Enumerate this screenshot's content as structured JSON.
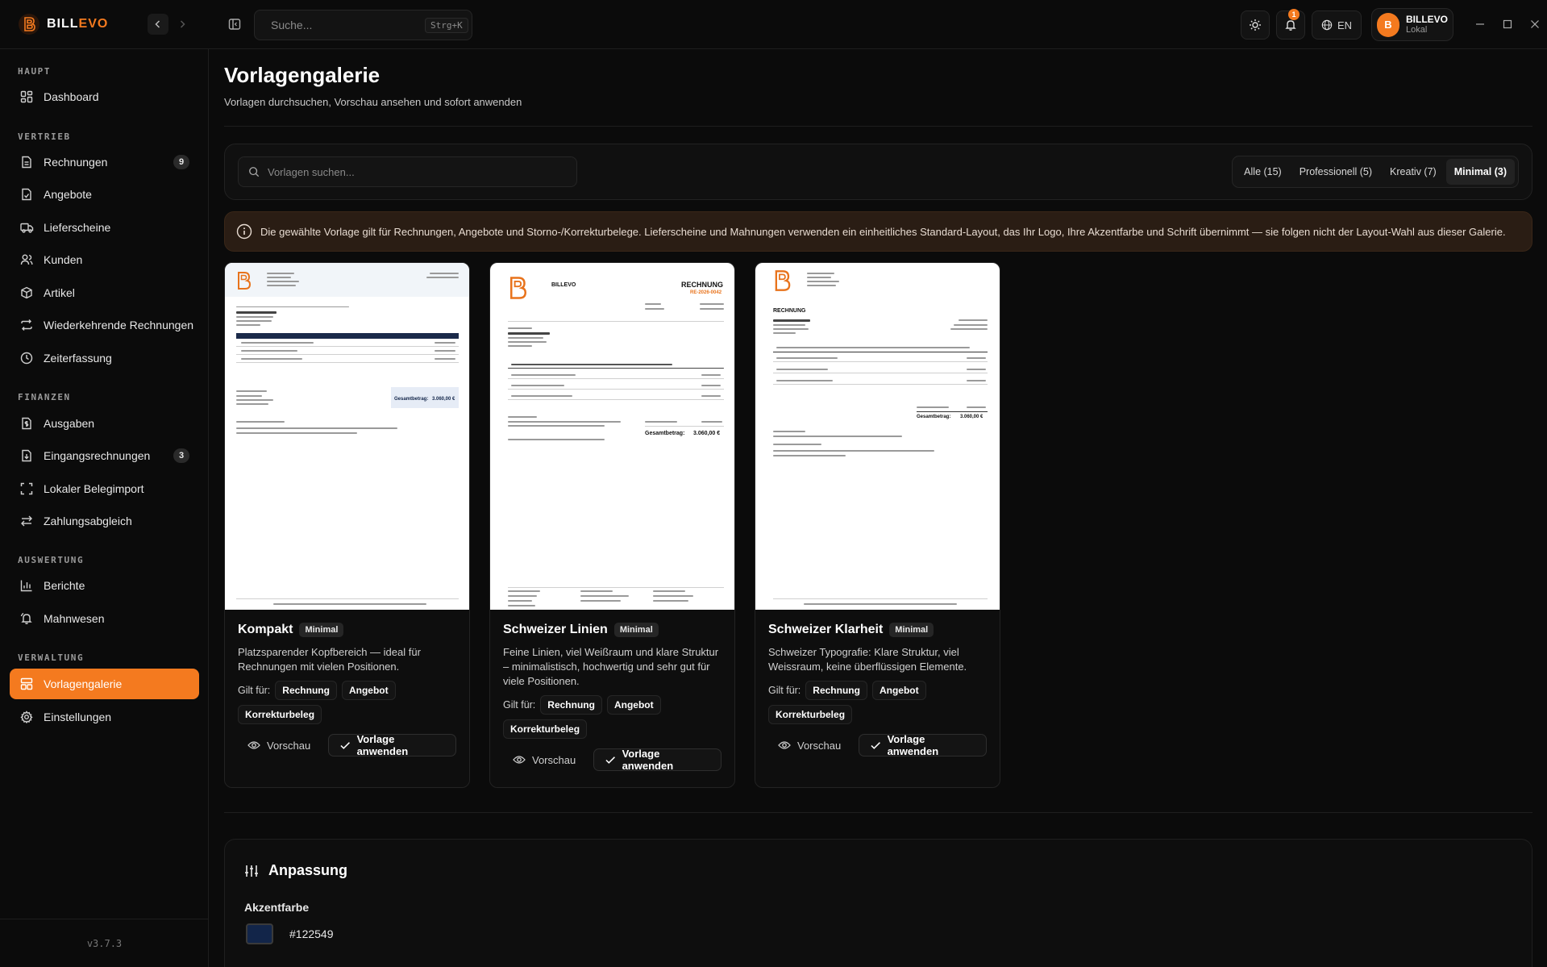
{
  "app": {
    "brand_prefix": "BILL",
    "brand_accent": "EVO",
    "version": "v3.7.3"
  },
  "topbar": {
    "search_placeholder": "Suche...",
    "search_shortcut": "Strg+K",
    "notifications_count": "1",
    "language": "EN",
    "user": {
      "initial": "B",
      "name": "BILLEVO",
      "sub": "Lokal"
    }
  },
  "sidebar": {
    "sections": [
      {
        "title": "HAUPT",
        "items": [
          {
            "label": "Dashboard",
            "icon": "dashboard-icon"
          }
        ]
      },
      {
        "title": "VERTRIEB",
        "items": [
          {
            "label": "Rechnungen",
            "icon": "invoice-icon",
            "count": "9"
          },
          {
            "label": "Angebote",
            "icon": "offer-icon"
          },
          {
            "label": "Lieferscheine",
            "icon": "truck-icon"
          },
          {
            "label": "Kunden",
            "icon": "users-icon"
          },
          {
            "label": "Artikel",
            "icon": "box-icon"
          },
          {
            "label": "Wiederkehrende Rechnungen",
            "icon": "repeat-icon"
          },
          {
            "label": "Zeiterfassung",
            "icon": "clock-icon"
          }
        ]
      },
      {
        "title": "FINANZEN",
        "items": [
          {
            "label": "Ausgaben",
            "icon": "wallet-icon"
          },
          {
            "label": "Eingangsrechnungen",
            "icon": "inbox-invoice-icon",
            "count": "3"
          },
          {
            "label": "Lokaler Belegimport",
            "icon": "scan-icon"
          },
          {
            "label": "Zahlungsabgleich",
            "icon": "swap-icon"
          }
        ]
      },
      {
        "title": "AUSWERTUNG",
        "items": [
          {
            "label": "Berichte",
            "icon": "bar-chart-icon"
          },
          {
            "label": "Mahnwesen",
            "icon": "bell-icon"
          }
        ]
      },
      {
        "title": "VERWALTUNG",
        "items": [
          {
            "label": "Vorlagengalerie",
            "icon": "layout-icon",
            "active": true
          },
          {
            "label": "Einstellungen",
            "icon": "gear-icon"
          }
        ]
      }
    ]
  },
  "main": {
    "title": "Vorlagengalerie",
    "subtitle": "Vorlagen durchsuchen, Vorschau ansehen und sofort anwenden",
    "search_placeholder": "Vorlagen suchen...",
    "filters": [
      {
        "label": "Alle (15)"
      },
      {
        "label": "Professionell (5)"
      },
      {
        "label": "Kreativ (7)"
      },
      {
        "label": "Minimal (3)",
        "active": true
      }
    ],
    "notice": "Die gewählte Vorlage gilt für Rechnungen, Angebote und Storno-/Korrekturbelege. Lieferscheine und Mahnungen verwenden ein einheitliches Standard-Layout, das Ihr Logo, Ihre Akzentfarbe und Schrift übernimmt — sie folgen nicht der Layout-Wahl aus dieser Galerie.",
    "applies_label": "Gilt für:",
    "preview_label": "Vorschau",
    "apply_label": "Vorlage anwenden",
    "templates": [
      {
        "name": "Kompakt",
        "category": "Minimal",
        "description": "Platzsparender Kopfbereich — ideal für Rechnungen mit vielen Positionen.",
        "applies": [
          "Rechnung",
          "Angebot",
          "Korrekturbeleg"
        ]
      },
      {
        "name": "Schweizer Linien",
        "category": "Minimal",
        "description": "Feine Linien, viel Weißraum und klare Struktur – minimalistisch, hochwertig und sehr gut für viele Positionen.",
        "applies": [
          "Rechnung",
          "Angebot",
          "Korrekturbeleg"
        ]
      },
      {
        "name": "Schweizer Klarheit",
        "category": "Minimal",
        "description": "Schweizer Typografie: Klare Struktur, viel Weissraum, keine überflüssigen Elemente.",
        "applies": [
          "Rechnung",
          "Angebot",
          "Korrekturbeleg"
        ]
      }
    ],
    "thumbs": [
      {
        "brand": "",
        "doc_title": "",
        "total_label": "Gesamtbetrag:",
        "total_value": "3.060,00 €"
      },
      {
        "brand": "BILLEVO",
        "doc_title": "RECHNUNG",
        "doc_number": "RE-2026-0042",
        "total_label": "Gesamtbetrag:",
        "total_value": "3.060,00 €"
      },
      {
        "brand": "",
        "doc_title": "RECHNUNG",
        "total_label": "Gesamtbetrag:",
        "total_value": "3.060,00 €"
      }
    ]
  },
  "anpassung": {
    "title": "Anpassung",
    "accent_label": "Akzentfarbe",
    "accent_hex": "#122549"
  },
  "colors": {
    "accent": "#f47a1f",
    "invoice_accent": "#122549"
  }
}
